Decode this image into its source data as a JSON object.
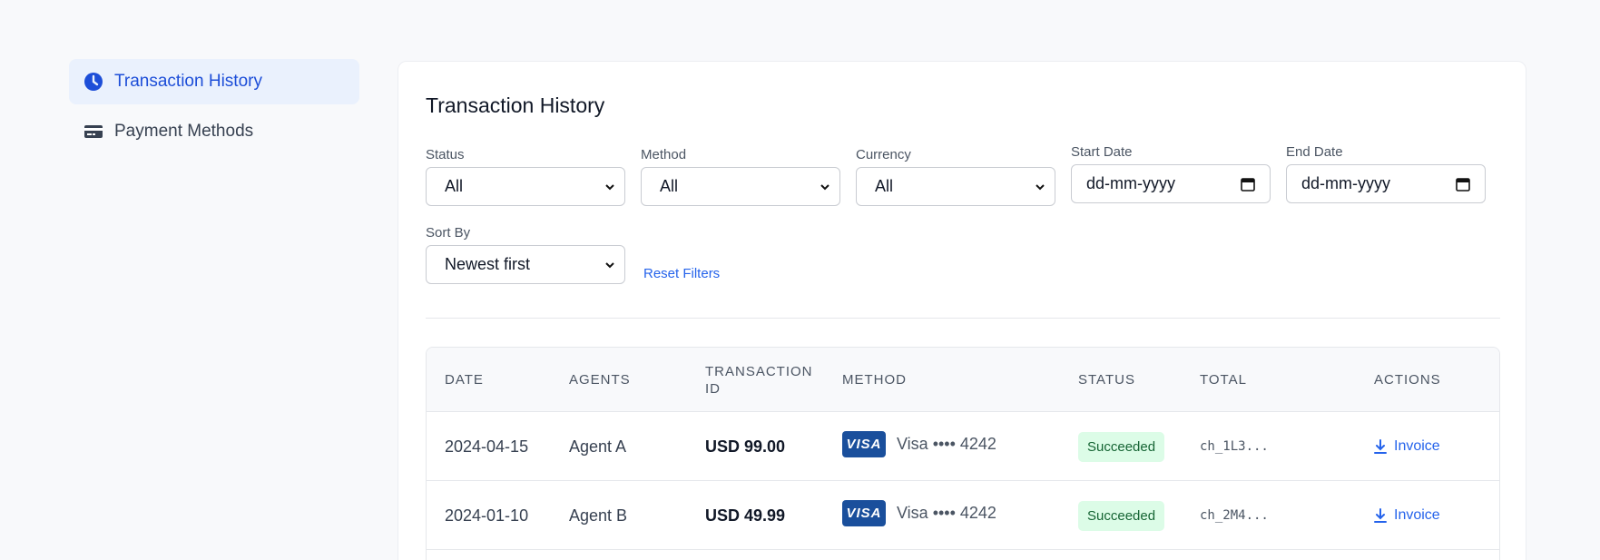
{
  "sidebar": {
    "items": [
      {
        "label": "Transaction History",
        "icon": "clock-icon",
        "active": true
      },
      {
        "label": "Payment Methods",
        "icon": "credit-card-icon",
        "active": false
      }
    ]
  },
  "main": {
    "title": "Transaction History",
    "filters": {
      "status": {
        "label": "Status",
        "value": "All"
      },
      "method": {
        "label": "Method",
        "value": "All"
      },
      "currency": {
        "label": "Currency",
        "value": "All"
      },
      "start_date": {
        "label": "Start Date",
        "placeholder": "dd-mm-yyyy"
      },
      "end_date": {
        "label": "End Date",
        "placeholder": "dd-mm-yyyy"
      },
      "sort_by": {
        "label": "Sort By",
        "value": "Newest first"
      },
      "reset_label": "Reset Filters"
    },
    "table": {
      "headers": [
        "DATE",
        "AGENTS",
        "TRANSACTION ID",
        "METHOD",
        "STATUS",
        "TOTAL",
        "ACTIONS"
      ],
      "rows": [
        {
          "date": "2024-04-15",
          "agent": "Agent A",
          "amount": "USD 99.00",
          "card_brand": "VISA",
          "method": "Visa •••• 4242",
          "status": "Succeeded",
          "tx_id": "ch_1L3...",
          "action": "Invoice"
        },
        {
          "date": "2024-01-10",
          "agent": "Agent B",
          "amount": "USD 49.99",
          "card_brand": "VISA",
          "method": "Visa •••• 4242",
          "status": "Succeeded",
          "tx_id": "ch_2M4...",
          "action": "Invoice"
        }
      ]
    }
  },
  "colors": {
    "accent": "#2563eb",
    "active_bg": "#eaf1fd",
    "success_bg": "#dcfce7",
    "success_text": "#166534",
    "visa_blue": "#1a4f9c"
  }
}
